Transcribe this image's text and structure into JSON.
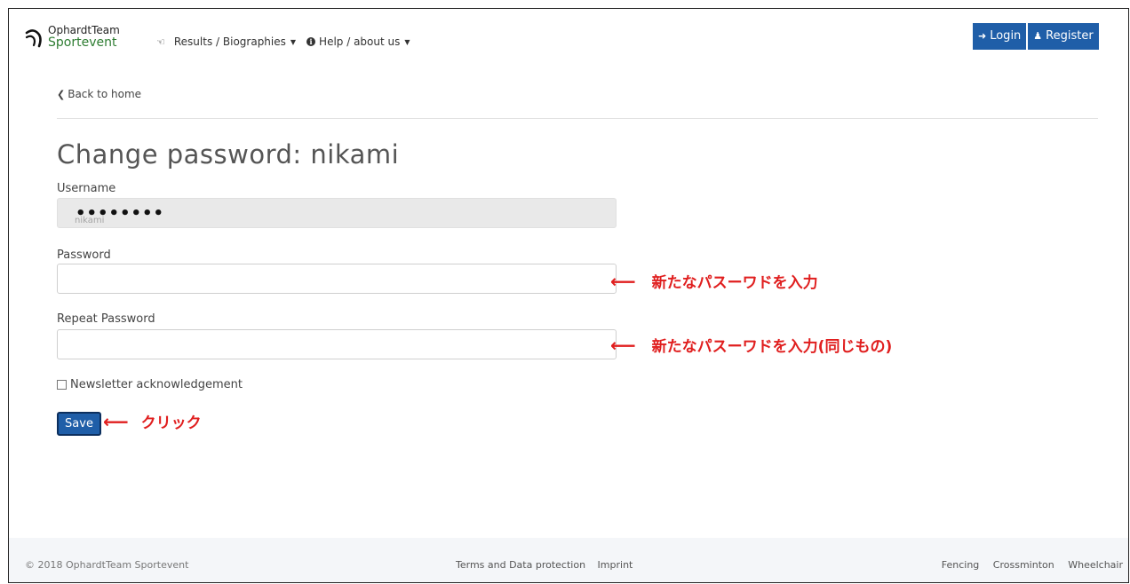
{
  "brand": {
    "line1": "OphardtTeam",
    "line2": "Sportevent"
  },
  "nav": {
    "home_icon": "home-icon",
    "results_label": "Results / Biographies",
    "help_label": "Help / about us"
  },
  "auth": {
    "login_label": "Login",
    "register_label": "Register"
  },
  "back_link": "Back to home",
  "page_title": "Change password: nikami",
  "form": {
    "username_label": "Username",
    "username_masked": "••••••••",
    "username_ghost": "nikami",
    "password_label": "Password",
    "password_value": "",
    "repeat_label": "Repeat Password",
    "repeat_value": "",
    "newsletter_label": "Newsletter acknowledgement",
    "save_label": "Save"
  },
  "annotations": {
    "password_note": "新たなパスーワドを入力",
    "repeat_note": "新たなパスーワドを入力(同じもの)",
    "save_note": "クリック"
  },
  "footer": {
    "copyright": "© 2018 OphardtTeam Sportevent",
    "terms": "Terms and Data protection",
    "imprint": "Imprint",
    "fencing": "Fencing",
    "crossminton": "Crossminton",
    "wheelchair": "Wheelchair"
  },
  "colors": {
    "primary": "#1f5ea8",
    "annotation": "#e01e1e",
    "brand_green": "#2e7d32"
  }
}
